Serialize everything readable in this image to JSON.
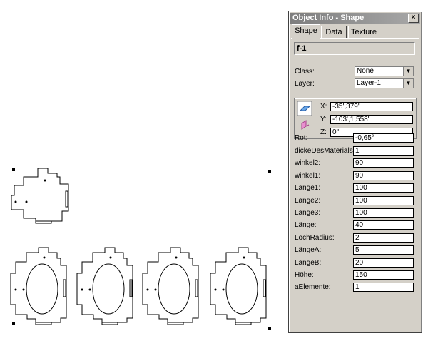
{
  "palette": {
    "title": "Object Info - Shape",
    "close_glyph": "×",
    "tabs": [
      "Shape",
      "Data",
      "Texture"
    ],
    "object_name": "f-1",
    "class_label": "Class:",
    "class_value": "None",
    "layer_label": "Layer:",
    "layer_value": "Layer-1",
    "x_label": "X:",
    "x_value": "-35',379\"",
    "y_label": "Y:",
    "y_value": "-103',1,558\"",
    "z_label": "Z:",
    "z_value": "0\"",
    "rot_label": "Rot:",
    "rot_value": "-0,65°",
    "params": [
      {
        "label": "dickeDesMaterials:",
        "value": "1"
      },
      {
        "label": "winkel2:",
        "value": "90"
      },
      {
        "label": "winkel1:",
        "value": "90"
      },
      {
        "label": "Länge1:",
        "value": "100"
      },
      {
        "label": "Länge2:",
        "value": "100"
      },
      {
        "label": "Länge3:",
        "value": "100"
      },
      {
        "label": "Länge:",
        "value": "40"
      },
      {
        "label": "LochRadius:",
        "value": "2"
      },
      {
        "label": "LängeA:",
        "value": "5"
      },
      {
        "label": "LängeB:",
        "value": "20"
      },
      {
        "label": "Höhe:",
        "value": "150"
      },
      {
        "label": "aElemente:",
        "value": "1"
      }
    ]
  },
  "icons": {
    "coord_top": "plane-xy-icon",
    "coord_bottom": "plane-z-icon",
    "dropdown": "chevron-down-icon",
    "close": "close-icon"
  },
  "colors": {
    "palette_bg": "#d4d0c8",
    "titlebar": "#8a8a8a"
  }
}
